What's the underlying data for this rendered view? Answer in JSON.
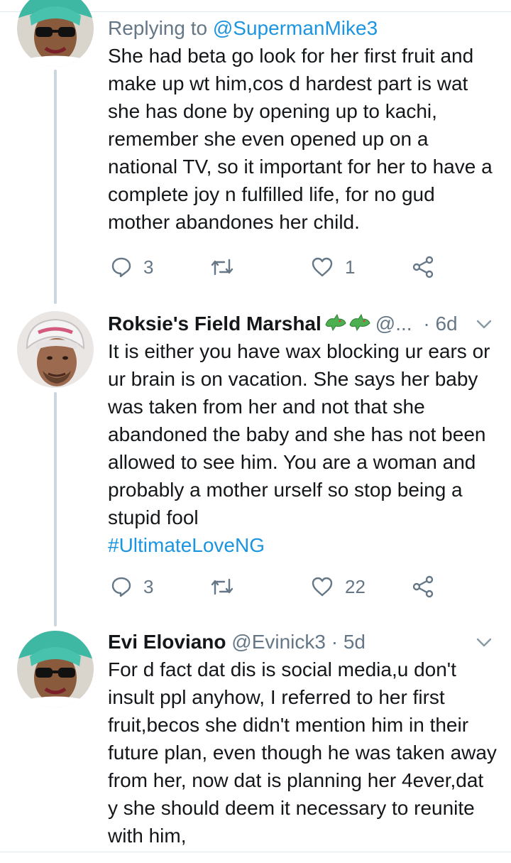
{
  "tweets": [
    {
      "reply_prefix": "Replying to ",
      "reply_handle": "@SupermanMike3",
      "text": "She had beta go look for her first fruit and make up wt him,cos d hardest part is wat she has done by opening up to kachi, remember she even opened up on a national TV, so it important for her to have a complete joy n fulfilled life, for no gud mother abandones her child.",
      "replies": "3",
      "retweets": "",
      "likes": "1"
    },
    {
      "name": "Roksie's Field Marshal",
      "handle": "@...",
      "separator": "·",
      "time": "6d",
      "text": "It is either you have wax blocking ur ears or ur brain is on vacation. She says her baby was taken from her and not that she abandoned the baby and she has not been allowed to see him. You are a woman and probably a mother urself so stop being a stupid fool",
      "hashtag": "#UltimateLoveNG",
      "replies": "3",
      "retweets": "",
      "likes": "22"
    },
    {
      "name": "Evi Eloviano",
      "handle": "@Evinick3",
      "separator": "·",
      "time": "5d",
      "text": "For d fact dat dis is social media,u don't insult ppl anyhow, I referred to her first fruit,becos she didn't mention him in their future plan, even though he was taken away from her, now dat is planning her 4ever,dat y she should deem it necessary to reunite with him,"
    }
  ],
  "icons": {
    "reply": "reply-icon",
    "retweet": "retweet-icon",
    "like": "heart-icon",
    "share": "share-icon",
    "menu": "chevron-down-icon",
    "emoji": "dragon-icon"
  },
  "colors": {
    "text": "#14171a",
    "secondary": "#657786",
    "link": "#1b95e0",
    "thread_line": "#ccd6dd",
    "divider": "#e1e8ed"
  }
}
